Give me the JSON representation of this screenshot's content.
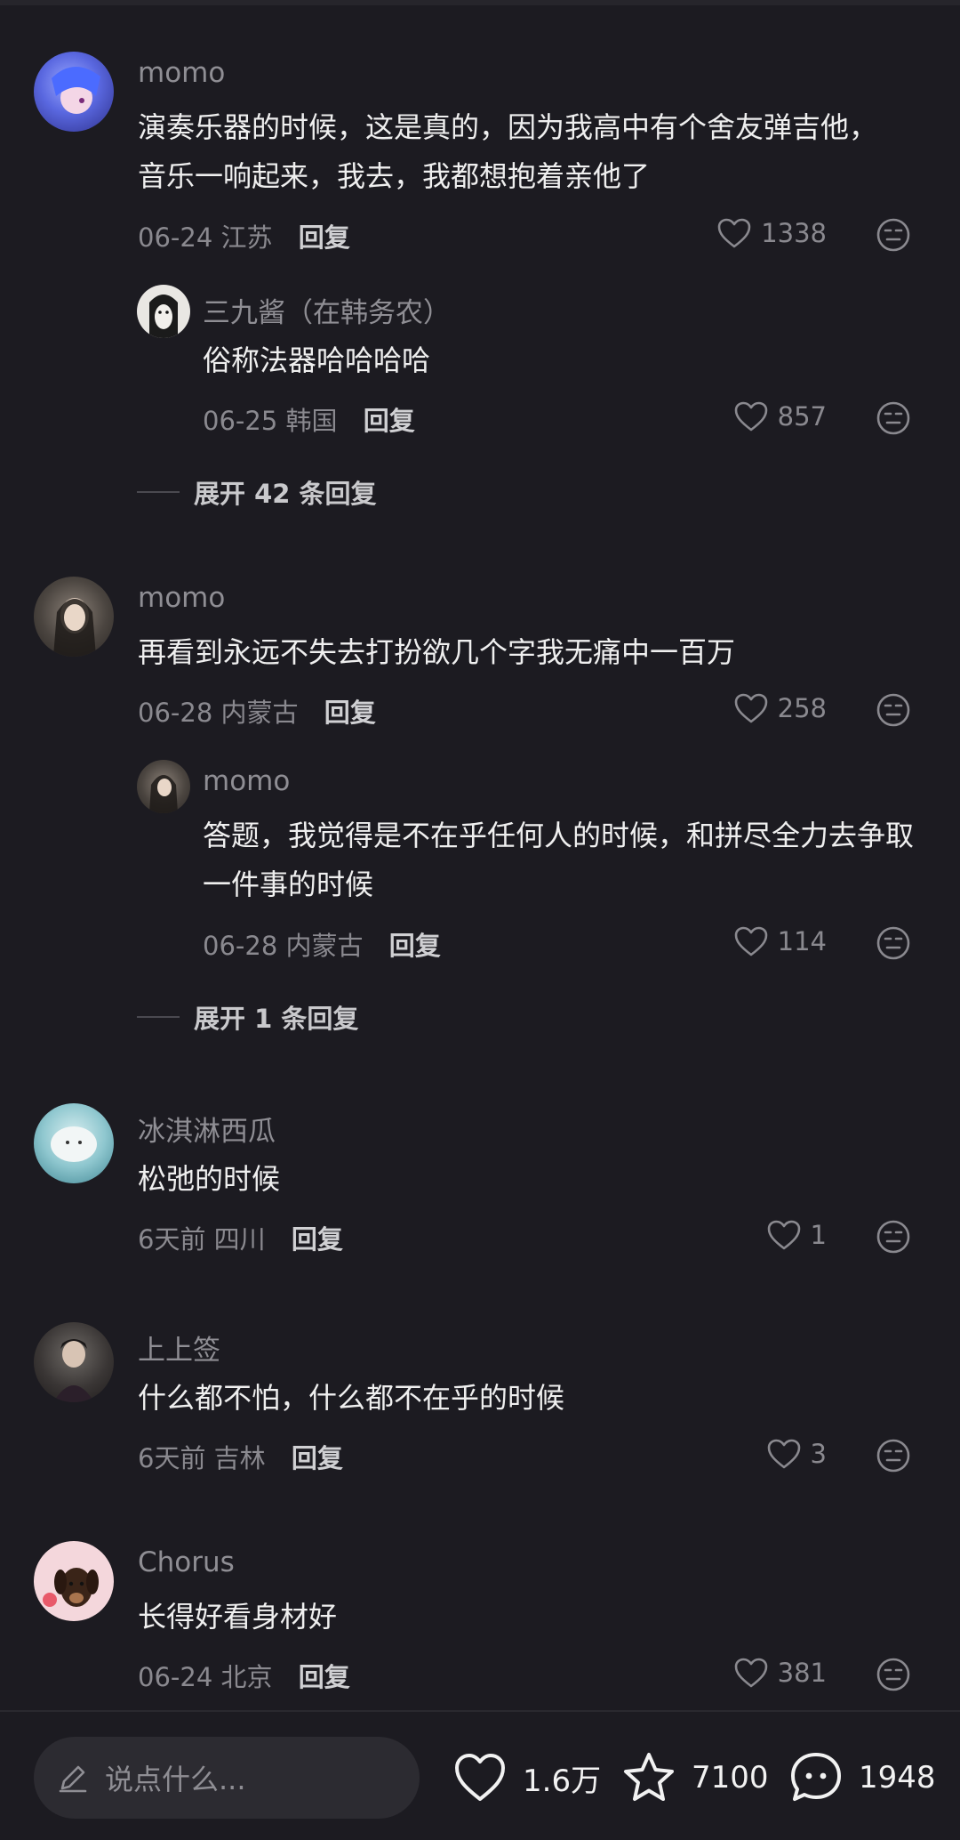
{
  "comments": [
    {
      "user": "momo",
      "text": "演奏乐器的时候，这是真的，因为我高中有个舍友弹吉他，音乐一响起来，我去，我都想抱着亲他了",
      "date": "06-24",
      "location": "江苏",
      "reply_label": "回复",
      "likes": "1338",
      "replies": [
        {
          "user": "三九酱（在韩务农）",
          "text": "俗称法器哈哈哈哈",
          "date": "06-25",
          "location": "韩国",
          "reply_label": "回复",
          "likes": "857"
        }
      ],
      "expand_label": "展开 42 条回复"
    },
    {
      "user": "momo",
      "text": "再看到永远不失去打扮欲几个字我无痛中一百万",
      "date": "06-28",
      "location": "内蒙古",
      "reply_label": "回复",
      "likes": "258",
      "replies": [
        {
          "user": "momo",
          "text": "答题，我觉得是不在乎任何人的时候，和拼尽全力去争取一件事的时候",
          "date": "06-28",
          "location": "内蒙古",
          "reply_label": "回复",
          "likes": "114"
        }
      ],
      "expand_label": "展开 1 条回复"
    },
    {
      "user": "冰淇淋西瓜",
      "text": "松弛的时候",
      "date": "6天前",
      "location": "四川",
      "reply_label": "回复",
      "likes": "1"
    },
    {
      "user": "上上签",
      "text": "什么都不怕，什么都不在乎的时候",
      "date": "6天前",
      "location": "吉林",
      "reply_label": "回复",
      "likes": "3"
    },
    {
      "user": "Chorus",
      "text": "长得好看身材好",
      "date": "06-24",
      "location": "北京",
      "reply_label": "回复",
      "likes": "381"
    }
  ],
  "bottom_bar": {
    "input_placeholder": "说点什么...",
    "likes": "1.6万",
    "favorites": "7100",
    "comments": "1948"
  },
  "colors": {
    "background": "#1c1b21",
    "muted_text": "#8a898f",
    "primary_text": "#efefef"
  }
}
